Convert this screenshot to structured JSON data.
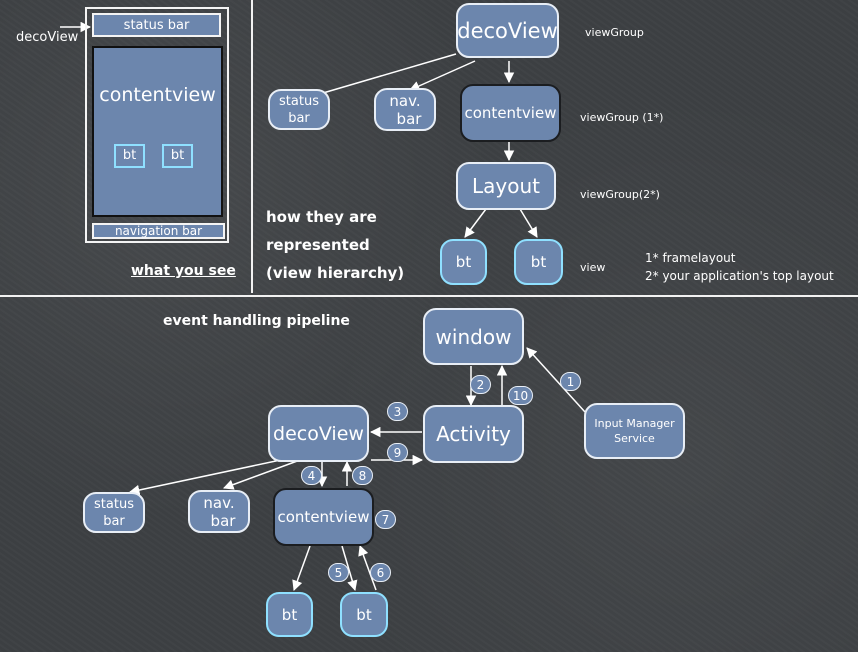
{
  "screen": {
    "decoview_label": "decoView",
    "status_bar": "status bar",
    "contentview": "contentview",
    "bt1": "bt",
    "bt2": "bt",
    "navigation_bar": "navigation bar",
    "caption": "what you see"
  },
  "hierarchy": {
    "caption_line1": "how they are",
    "caption_line2": "represented",
    "caption_line3": "(view hierarchy)",
    "decoview": "decoView",
    "status_bar_l1": "status",
    "status_bar_l2": "bar",
    "nav_bar_l1": "nav.",
    "nav_bar_l2": "bar",
    "contentview": "contentview",
    "layout": "Layout",
    "bt1": "bt",
    "bt2": "bt",
    "type_decoview": "viewGroup",
    "type_contentview": "viewGroup (1*)",
    "type_layout": "viewGroup(2*)",
    "type_view": "view",
    "note1": "1*  framelayout",
    "note2": "2*  your application's top layout"
  },
  "pipeline": {
    "title": "event handling pipeline",
    "window": "window",
    "activity": "Activity",
    "input_manager_l1": "Input Manager",
    "input_manager_l2": "Service",
    "decoview": "decoView",
    "status_bar_l1": "status",
    "status_bar_l2": "bar",
    "nav_bar_l1": "nav.",
    "nav_bar_l2": "bar",
    "contentview": "contentview",
    "bt1": "bt",
    "bt2": "bt",
    "steps": [
      "1",
      "2",
      "3",
      "4",
      "5",
      "6",
      "7",
      "8",
      "9",
      "10"
    ]
  }
}
